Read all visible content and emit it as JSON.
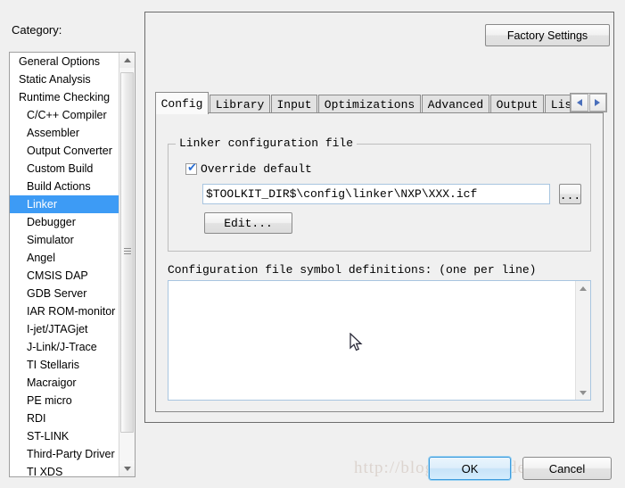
{
  "colors": {
    "accent_selection": "#3d9bf5",
    "window_bg": "#f0f0f0",
    "field_bg": "#ffffff",
    "ok_focus_border": "#3c9bdd",
    "watermark": "#dcd4cf"
  },
  "category": {
    "label": "Category:",
    "items": [
      {
        "label": "General Options",
        "indent": false,
        "selected": false
      },
      {
        "label": "Static Analysis",
        "indent": false,
        "selected": false
      },
      {
        "label": "Runtime Checking",
        "indent": false,
        "selected": false
      },
      {
        "label": "C/C++ Compiler",
        "indent": true,
        "selected": false
      },
      {
        "label": "Assembler",
        "indent": true,
        "selected": false
      },
      {
        "label": "Output Converter",
        "indent": true,
        "selected": false
      },
      {
        "label": "Custom Build",
        "indent": true,
        "selected": false
      },
      {
        "label": "Build Actions",
        "indent": true,
        "selected": false
      },
      {
        "label": "Linker",
        "indent": true,
        "selected": true
      },
      {
        "label": "Debugger",
        "indent": true,
        "selected": false
      },
      {
        "label": "Simulator",
        "indent": true,
        "selected": false
      },
      {
        "label": "Angel",
        "indent": true,
        "selected": false
      },
      {
        "label": "CMSIS DAP",
        "indent": true,
        "selected": false
      },
      {
        "label": "GDB Server",
        "indent": true,
        "selected": false
      },
      {
        "label": "IAR ROM-monitor",
        "indent": true,
        "selected": false
      },
      {
        "label": "I-jet/JTAGjet",
        "indent": true,
        "selected": false
      },
      {
        "label": "J-Link/J-Trace",
        "indent": true,
        "selected": false
      },
      {
        "label": "TI Stellaris",
        "indent": true,
        "selected": false
      },
      {
        "label": "Macraigor",
        "indent": true,
        "selected": false
      },
      {
        "label": "PE micro",
        "indent": true,
        "selected": false
      },
      {
        "label": "RDI",
        "indent": true,
        "selected": false
      },
      {
        "label": "ST-LINK",
        "indent": true,
        "selected": false
      },
      {
        "label": "Third-Party Driver",
        "indent": true,
        "selected": false
      },
      {
        "label": "TI XDS",
        "indent": true,
        "selected": false
      }
    ]
  },
  "toolbar": {
    "factory_settings_label": "Factory Settings"
  },
  "tabs": {
    "items": [
      {
        "label": "Config",
        "active": true
      },
      {
        "label": "Library",
        "active": false
      },
      {
        "label": "Input",
        "active": false
      },
      {
        "label": "Optimizations",
        "active": false
      },
      {
        "label": "Advanced",
        "active": false
      },
      {
        "label": "Output",
        "active": false
      },
      {
        "label": "Lis",
        "active": false
      }
    ],
    "nav_prev_icon": "chevron-left-icon",
    "nav_next_icon": "chevron-right-icon"
  },
  "config_tab": {
    "group_title": "Linker configuration file",
    "override_checkbox": {
      "label": "Override default",
      "checked": true,
      "glyph": "✔"
    },
    "path_value": "$TOOLKIT_DIR$\\config\\linker\\NXP\\XXX.icf",
    "browse_label": "...",
    "edit_label": "Edit...",
    "symbol_defs_label": "Configuration file symbol definitions: (one per line)",
    "symbol_defs_value": ""
  },
  "footer": {
    "ok_label": "OK",
    "cancel_label": "Cancel",
    "watermark": "http://blog.csdn.net/deguoc"
  }
}
